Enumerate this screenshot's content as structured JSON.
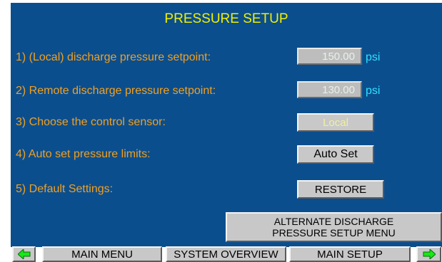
{
  "screen": {
    "title": "PRESSURE SETUP"
  },
  "rows": [
    {
      "label": "1) (Local) discharge pressure setpoint:",
      "value": "150.00",
      "unit": "psi"
    },
    {
      "label": "2) Remote discharge pressure setpoint:",
      "value": "130.00",
      "unit": "psi"
    },
    {
      "label": "3) Choose the control sensor:",
      "button": "Local"
    },
    {
      "label": "4) Auto set pressure limits:",
      "button": "Auto Set"
    },
    {
      "label": "5) Default Settings:",
      "button": "RESTORE"
    }
  ],
  "alternate_button": {
    "line1": "ALTERNATE DISCHARGE",
    "line2": "PRESSURE SETUP MENU"
  },
  "nav": {
    "left_icon": "arrow-left-icon",
    "main_menu": "MAIN MENU",
    "system_overview": "SYSTEM OVERVIEW",
    "main_setup": "MAIN SETUP",
    "right_icon": "arrow-right-icon"
  },
  "colors": {
    "panel_bg": "#0b4e8e",
    "title": "#f0f000",
    "label": "#f0a020",
    "unit": "#2ee0ff",
    "button_face": "#c8c8c8",
    "arrow_green": "#18e818"
  }
}
